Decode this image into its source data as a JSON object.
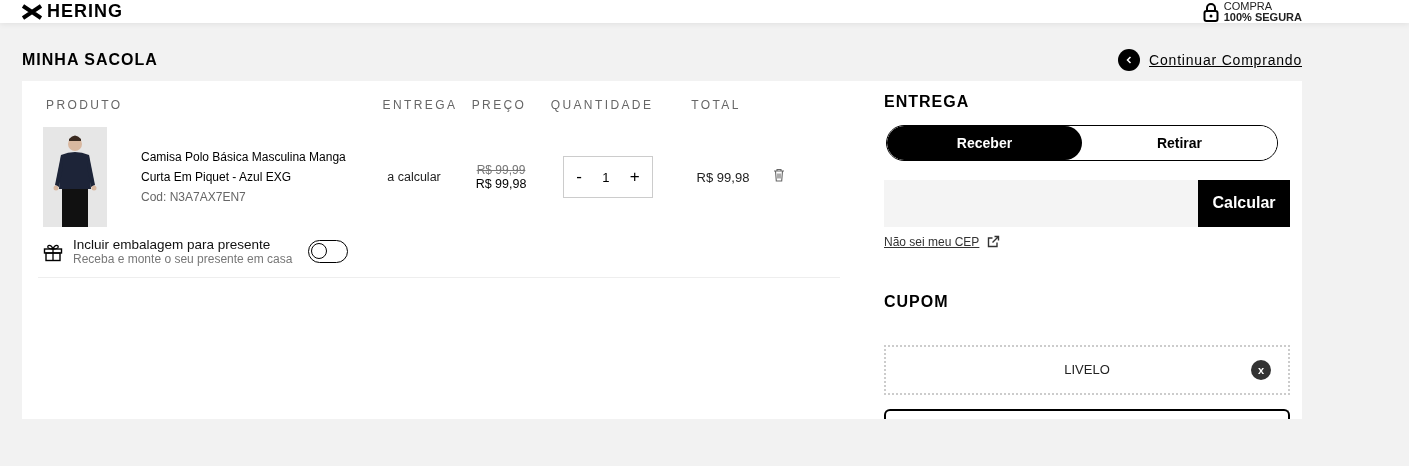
{
  "header": {
    "logo": "HERING",
    "secure": [
      "COMPRA",
      "100% SEGURA"
    ]
  },
  "page_title": "MINHA SACOLA",
  "continue_link": "Continuar Comprando",
  "table": {
    "columns": [
      "PRODUTO",
      "ENTREGA",
      "PREÇO",
      "QUANTIDADE",
      "TOTAL"
    ],
    "rows": [
      {
        "name": "Camisa Polo Básica Masculina Manga Curta Em Piquet - Azul EXG",
        "code": "Cod: N3A7AX7EN7",
        "delivery": "a calcular",
        "old_price": "R$ 99,99",
        "price": "R$ 99,98",
        "quantity": {
          "minus": "-",
          "value": "1",
          "plus": "+"
        },
        "total": "R$ 99,98"
      }
    ]
  },
  "gift": {
    "title": "Incluir embalagem para presente",
    "subtitle": "Receba e monte o seu presente em casa",
    "on": false
  },
  "delivery": {
    "title": "ENTREGA",
    "options": [
      {
        "label": "Receber",
        "selected": true
      },
      {
        "label": "Retirar",
        "selected": false
      }
    ],
    "button": "Calcular",
    "link": "Não sei meu CEP"
  },
  "coupon": {
    "title": "CUPOM",
    "code": "LIVELO",
    "remove": "x"
  }
}
